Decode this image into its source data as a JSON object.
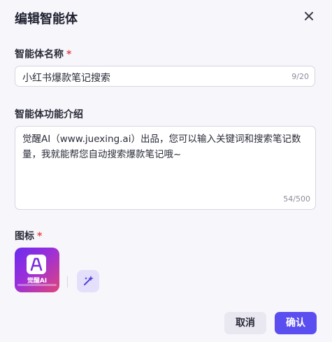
{
  "dialog": {
    "title": "编辑智能体",
    "close_icon": "close-icon"
  },
  "form": {
    "name": {
      "label": "智能体名称",
      "required_mark": "*",
      "value": "小红书爆款笔记搜索",
      "count": "9/20"
    },
    "description": {
      "label": "智能体功能介绍",
      "value": "觉醒AI（www.juexing.ai）出品，您可以输入关键词和搜索笔记数量，我就能帮您自动搜索爆款笔记哦~",
      "count": "54/500"
    },
    "icon": {
      "label": "图标",
      "required_mark": "*",
      "brand_text": "觉醒AI",
      "magic_icon": "sparkle-icon"
    }
  },
  "footer": {
    "cancel_label": "取消",
    "ok_label": "确认"
  },
  "colors": {
    "accent": "#5b4ef0",
    "required": "#e5484d"
  }
}
